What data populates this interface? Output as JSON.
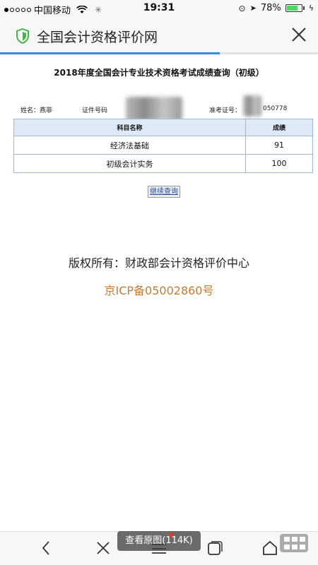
{
  "status_bar": {
    "carrier": "中国移动",
    "time": "19:31",
    "battery": "78%",
    "battery_level": 0.78,
    "signal_bars_filled": 1,
    "signal_bars_total": 5
  },
  "header": {
    "site_title": "全国会计资格评价网",
    "load_progress": 0.69
  },
  "report": {
    "title": "2018年度全国会计专业技术资格考试成绩查询（初级）",
    "name_label": "姓名：",
    "name_value": "燕菲",
    "id_label": "证件号码",
    "admission_label": "准考证号：",
    "admission_value": "050778",
    "columns": [
      "科目名称",
      "成绩"
    ],
    "rows": [
      {
        "subject": "经济法基础",
        "score": "91"
      },
      {
        "subject": "初级会计实务",
        "score": "100"
      }
    ],
    "continue_label": "继续查询"
  },
  "footer": {
    "copyright": "版权所有：财政部会计资格评价中心",
    "icp": "京ICP备05002860号"
  },
  "toolbar": {
    "view_original": "查看原图(114K)"
  },
  "colors": {
    "accent_blue": "#3a8de0",
    "shield_green": "#4caf50",
    "icp_orange": "#c87a2e",
    "table_header_bg": "#dde9f6"
  }
}
